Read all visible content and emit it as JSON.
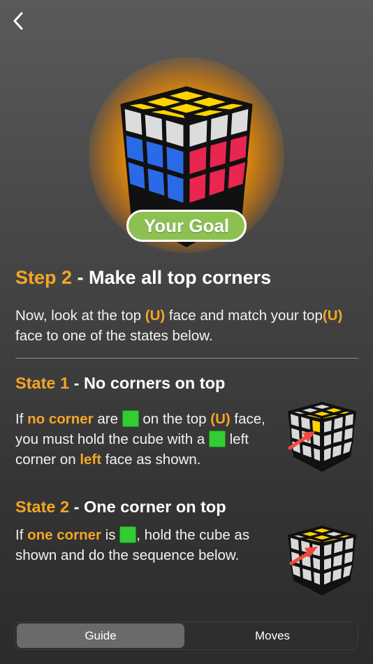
{
  "nav": {
    "back_icon": "chevron-left-icon"
  },
  "hero": {
    "badge": "Your Goal"
  },
  "step": {
    "prefix": "Step 2",
    "title": " - Make all top corners"
  },
  "intro": {
    "t1": "Now, look at the top ",
    "u1": "(U)",
    "t2": " face and match your top",
    "u2": "(U)",
    "t3": " face to one of the states below."
  },
  "state1": {
    "prefix": "State 1",
    "title": " - No corners on top",
    "t1": "If ",
    "b1": "no corner",
    "t2": " are ",
    "t3": " on the top ",
    "b2": "(U)",
    "t4": " face, you must hold the cube with a ",
    "t5": " left corner on ",
    "b3": "left",
    "t6": " face as shown."
  },
  "state2": {
    "prefix": "State 2",
    "title": " - One corner on top",
    "t1": "If ",
    "b1": "one corner",
    "t2": " is ",
    "t3": ", hold the cube as shown and do the sequence below."
  },
  "tabs": {
    "guide": "Guide",
    "moves": "Moves"
  },
  "colors": {
    "accent": "#f5a623",
    "badge_green": "#8cc152",
    "cube_yellow": "#ffd400",
    "cube_blue": "#2b6ae6",
    "cube_red": "#e8264f",
    "cube_white": "#d8d8d8",
    "marker_green": "#33cc33",
    "arrow_red": "#ef4b3c"
  }
}
